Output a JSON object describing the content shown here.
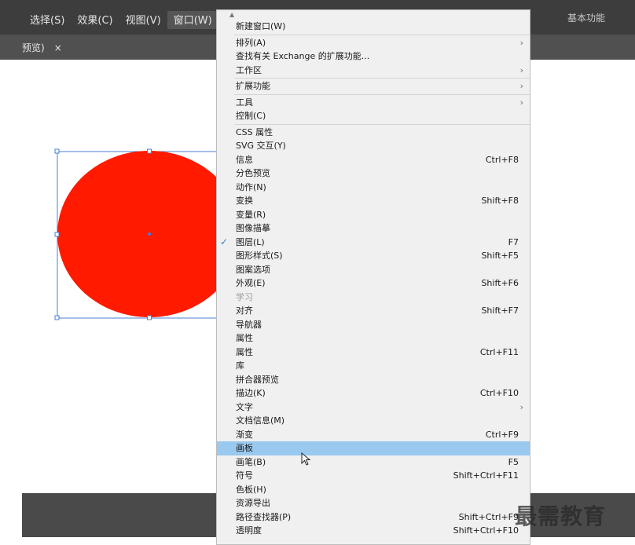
{
  "menubar": {
    "items": [
      {
        "label": "选择(S)",
        "active": false
      },
      {
        "label": "效果(C)",
        "active": false
      },
      {
        "label": "视图(V)",
        "active": false
      },
      {
        "label": "窗口(W)",
        "active": true
      }
    ],
    "workspace": "基本功能"
  },
  "document_tab": {
    "label": "预览)",
    "close": "×"
  },
  "colors": {
    "circle_fill": "#ff1a00",
    "selection": "#4a7fd4",
    "highlight": "#99c9ef"
  },
  "menu": {
    "rows": [
      {
        "type": "item",
        "label": "新建窗口(W)"
      },
      {
        "type": "sep"
      },
      {
        "type": "item",
        "label": "排列(A)",
        "submenu": true
      },
      {
        "type": "item",
        "label": "查找有关 Exchange 的扩展功能..."
      },
      {
        "type": "item",
        "label": "工作区",
        "submenu": true
      },
      {
        "type": "sep"
      },
      {
        "type": "item",
        "label": "扩展功能",
        "submenu": true
      },
      {
        "type": "sep"
      },
      {
        "type": "item",
        "label": "工具",
        "submenu": true
      },
      {
        "type": "item",
        "label": "控制(C)"
      },
      {
        "type": "sep"
      },
      {
        "type": "item",
        "label": "CSS 属性"
      },
      {
        "type": "item",
        "label": "SVG 交互(Y)"
      },
      {
        "type": "item",
        "label": "信息",
        "shortcut": "Ctrl+F8"
      },
      {
        "type": "item",
        "label": "分色预览"
      },
      {
        "type": "item",
        "label": "动作(N)"
      },
      {
        "type": "item",
        "label": "变换",
        "shortcut": "Shift+F8"
      },
      {
        "type": "item",
        "label": "变量(R)"
      },
      {
        "type": "item",
        "label": "图像描摹"
      },
      {
        "type": "item",
        "label": "图层(L)",
        "shortcut": "F7",
        "checked": true
      },
      {
        "type": "item",
        "label": "图形样式(S)",
        "shortcut": "Shift+F5"
      },
      {
        "type": "item",
        "label": "图案选项"
      },
      {
        "type": "item",
        "label": "外观(E)",
        "shortcut": "Shift+F6"
      },
      {
        "type": "item",
        "label": "学习",
        "disabled": true
      },
      {
        "type": "item",
        "label": "对齐",
        "shortcut": "Shift+F7"
      },
      {
        "type": "item",
        "label": "导航器"
      },
      {
        "type": "item",
        "label": "属性"
      },
      {
        "type": "item",
        "label": "属性",
        "shortcut": "Ctrl+F11"
      },
      {
        "type": "item",
        "label": "库"
      },
      {
        "type": "item",
        "label": "拼合器预览"
      },
      {
        "type": "item",
        "label": "描边(K)",
        "shortcut": "Ctrl+F10"
      },
      {
        "type": "item",
        "label": "文字",
        "submenu": true
      },
      {
        "type": "item",
        "label": "文档信息(M)"
      },
      {
        "type": "item",
        "label": "渐变",
        "shortcut": "Ctrl+F9"
      },
      {
        "type": "item",
        "label": "画板",
        "highlight": true
      },
      {
        "type": "item",
        "label": "画笔(B)",
        "shortcut": "F5"
      },
      {
        "type": "item",
        "label": "符号",
        "shortcut": "Shift+Ctrl+F11"
      },
      {
        "type": "item",
        "label": "色板(H)"
      },
      {
        "type": "item",
        "label": "资源导出"
      },
      {
        "type": "item",
        "label": "路径查找器(P)",
        "shortcut": "Shift+Ctrl+F9"
      },
      {
        "type": "item",
        "label": "透明度",
        "shortcut": "Shift+Ctrl+F10"
      }
    ]
  },
  "watermark": "最需教育"
}
